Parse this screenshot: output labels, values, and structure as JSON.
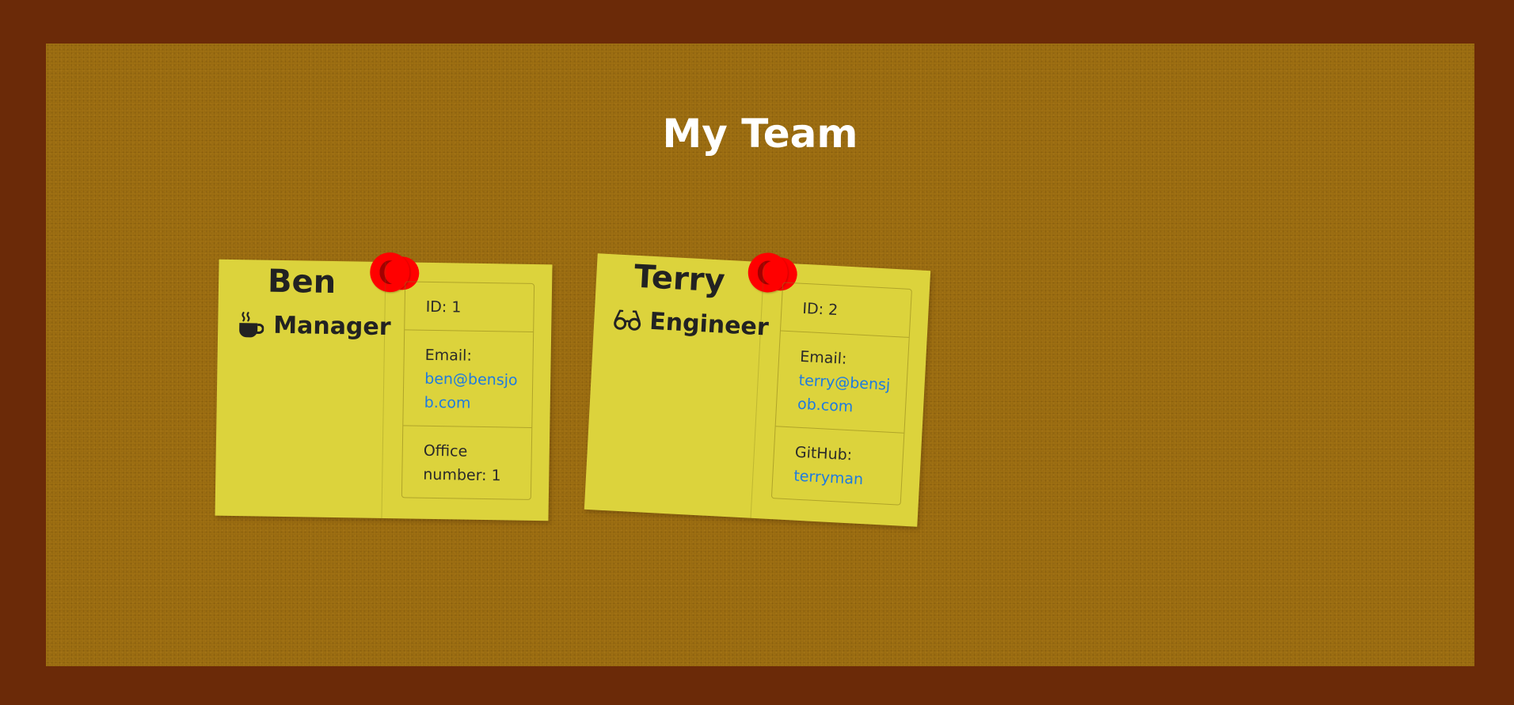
{
  "page": {
    "title": "My Team"
  },
  "colors": {
    "frame": "#6b2a08",
    "board": "#9e6f12",
    "card": "#dcd33c",
    "pin": "#ff0000",
    "link": "#1e7be0"
  },
  "team": [
    {
      "name": "Ben",
      "role": "Manager",
      "role_icon": "coffee-cup-icon",
      "details": {
        "id": "ID: 1",
        "email_label": "Email:",
        "email": "ben@bensjob.com",
        "extra_label": "Office number: 1",
        "extra_value": ""
      }
    },
    {
      "name": "Terry",
      "role": "Engineer",
      "role_icon": "glasses-icon",
      "details": {
        "id": "ID: 2",
        "email_label": "Email:",
        "email": "terry@bensjob.com",
        "extra_label": "GitHub:",
        "extra_value": "terryman"
      }
    }
  ]
}
